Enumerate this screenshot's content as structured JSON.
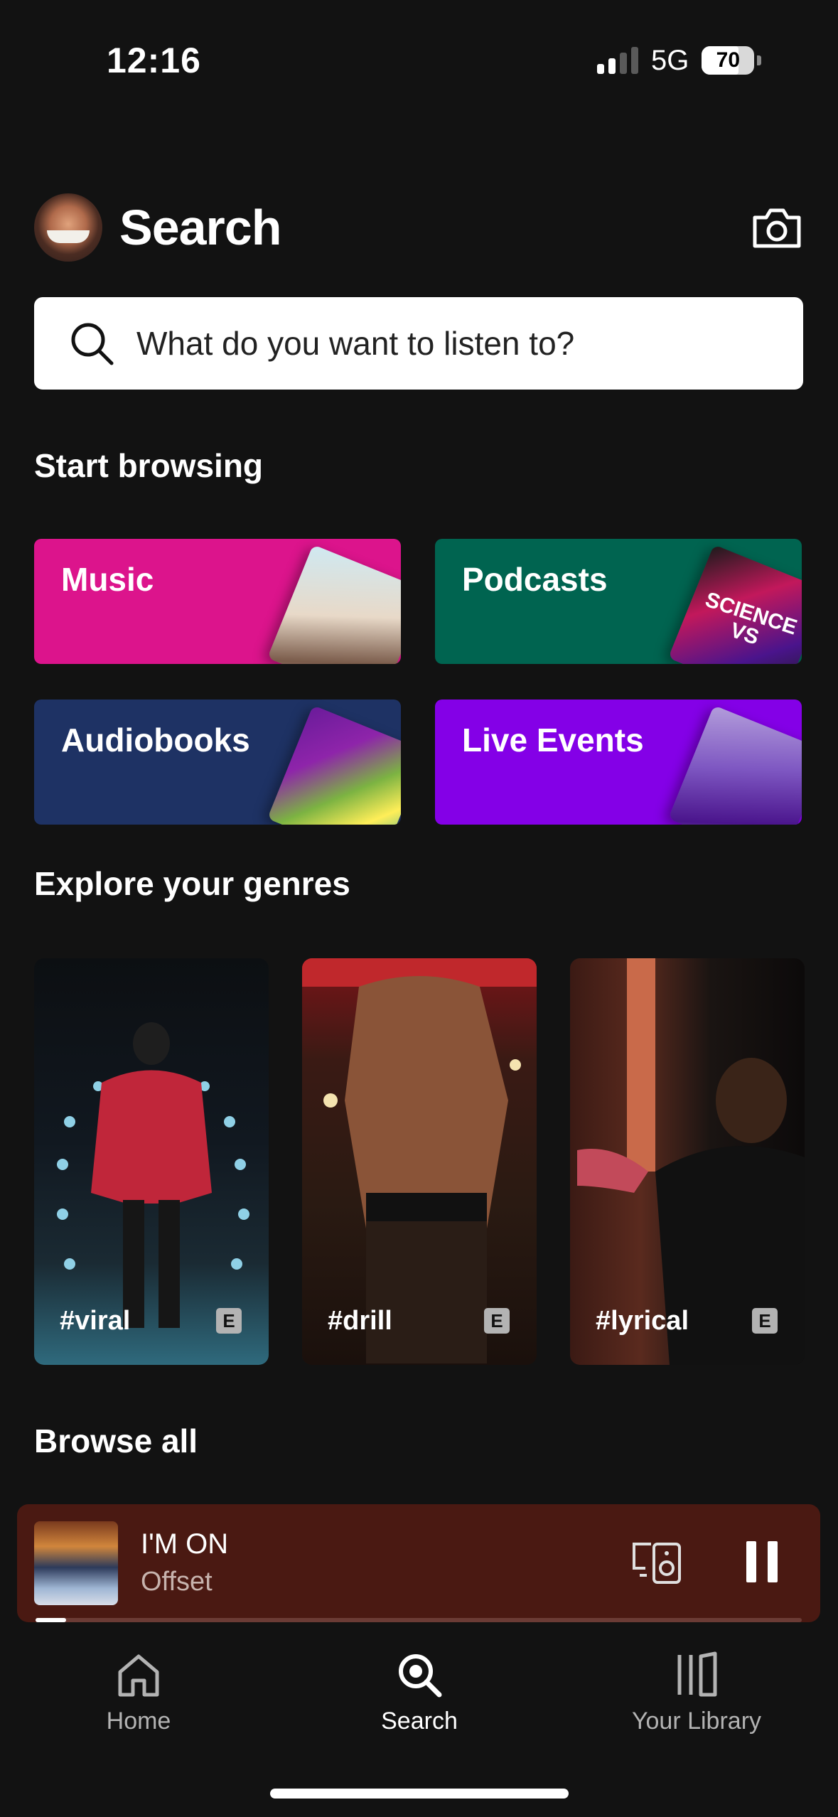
{
  "status": {
    "time": "12:16",
    "network": "5G",
    "battery": "70"
  },
  "header": {
    "title": "Search"
  },
  "search": {
    "placeholder": "What do you want to listen to?"
  },
  "sections": {
    "start_browsing": "Start browsing",
    "explore_genres": "Explore your genres",
    "browse_all": "Browse all"
  },
  "browse_tiles": [
    {
      "label": "Music",
      "color": "#dc148c"
    },
    {
      "label": "Podcasts",
      "color": "#006450"
    },
    {
      "label": "Audiobooks",
      "color": "#1e3264"
    },
    {
      "label": "Live Events",
      "color": "#8400e7"
    }
  ],
  "podcast_art_text": "SCIENCE VS",
  "genres": [
    {
      "tag": "#viral",
      "explicit": "E"
    },
    {
      "tag": "#drill",
      "explicit": "E"
    },
    {
      "tag": "#lyrical",
      "explicit": "E"
    }
  ],
  "now_playing": {
    "title": "I'M ON",
    "artist": "Offset",
    "progress": 0.04,
    "bg_color": "#4a1912"
  },
  "tabs": [
    {
      "label": "Home",
      "icon": "home-icon",
      "active": false
    },
    {
      "label": "Search",
      "icon": "search-icon",
      "active": true
    },
    {
      "label": "Your Library",
      "icon": "library-icon",
      "active": false
    }
  ]
}
